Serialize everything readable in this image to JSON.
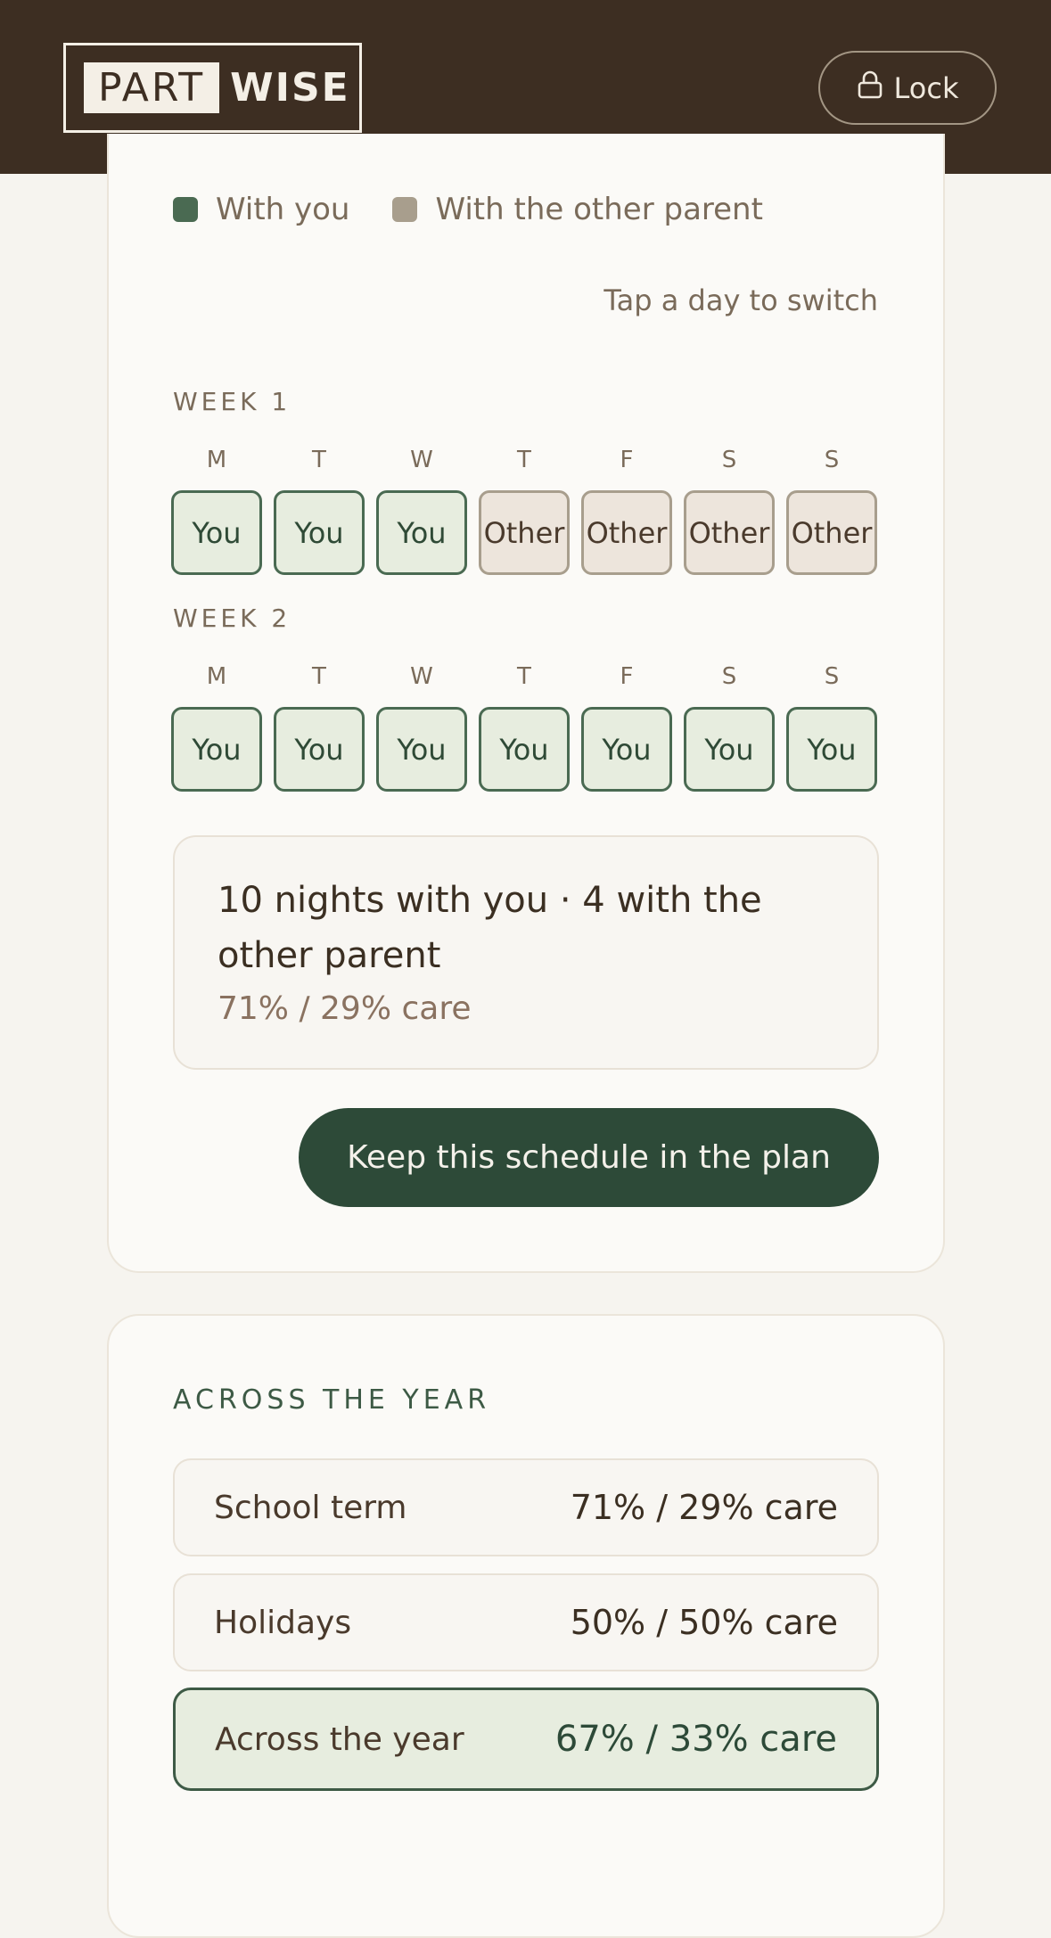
{
  "header": {
    "logo_part": "PART",
    "logo_wise": "WISE",
    "lock_label": "Lock"
  },
  "legend": {
    "you": "With you",
    "other": "With the other parent",
    "colors": {
      "you": "#4a6a52",
      "other": "#a89e8d"
    }
  },
  "hint": "Tap a day to switch",
  "weeks": [
    {
      "label": "WEEK 1",
      "days": [
        "M",
        "T",
        "W",
        "T",
        "F",
        "S",
        "S"
      ],
      "cells": [
        "You",
        "You",
        "You",
        "Other",
        "Other",
        "Other",
        "Other"
      ]
    },
    {
      "label": "WEEK 2",
      "days": [
        "M",
        "T",
        "W",
        "T",
        "F",
        "S",
        "S"
      ],
      "cells": [
        "You",
        "You",
        "You",
        "You",
        "You",
        "You",
        "You"
      ]
    }
  ],
  "summary": {
    "main": "10 nights with you · 4 with the other parent",
    "sub": "71% / 29% care"
  },
  "keep_button": "Keep this schedule in the plan",
  "year": {
    "title": "ACROSS THE YEAR",
    "rows": [
      {
        "label": "School term",
        "value": "71% / 29% care"
      },
      {
        "label": "Holidays",
        "value": "50% / 50% care"
      },
      {
        "label": "Across the year",
        "value": "67% / 33% care"
      }
    ]
  }
}
